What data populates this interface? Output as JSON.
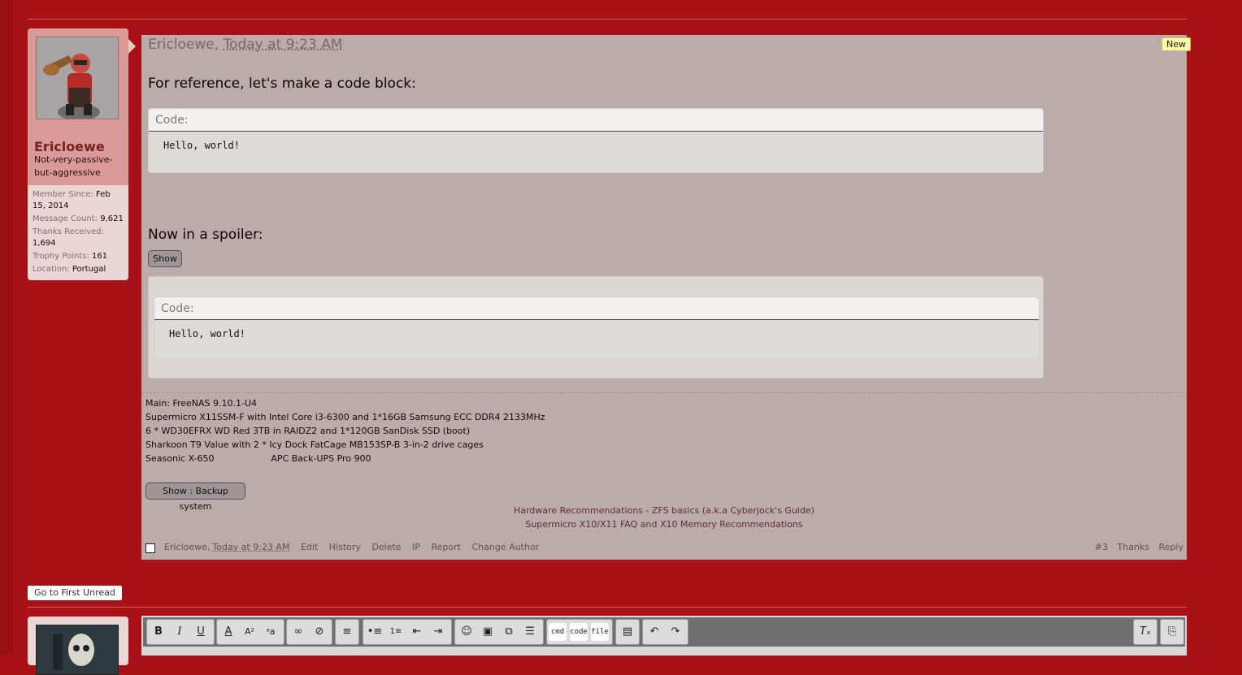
{
  "post": {
    "author": "Ericloewe",
    "author_comma": "Ericloewe,",
    "time": "Today at 9:23 AM",
    "new_badge": "New",
    "text1": "For reference, let's make a code block:",
    "code1_label": "Code:",
    "code1_content": "Hello, world!",
    "text2": "Now in a spoiler:",
    "spoiler_button": "Show",
    "code2_label": "Code:",
    "code2_content": "Hello, world!"
  },
  "user": {
    "name": "Ericloewe",
    "title": "Not-very-passive-but-aggressive",
    "stats": [
      {
        "label": "Member Since:",
        "value": "Feb 15, 2014"
      },
      {
        "label": "Message Count:",
        "value": "9,621"
      },
      {
        "label": "Thanks Received:",
        "value": "1,694"
      },
      {
        "label": "Trophy Points:",
        "value": "161"
      },
      {
        "label": "Location:",
        "value": "Portugal"
      }
    ]
  },
  "signature": {
    "lines": [
      "Main: FreeNAS 9.10.1-U4",
      "Supermicro X11SSM-F with Intel Core i3-6300 and 1*16GB Samsung ECC DDR4 2133MHz",
      "6 * WD30EFRX WD Red 3TB in RAIDZ2 and 1*120GB SanDisk SSD (boot)",
      "Sharkoon T9 Value with 2 * Icy Dock FatCage MB153SP-B 3-in-2 drive cages",
      "Seasonic X-650                    APC Back-UPS Pro 900"
    ],
    "backup_button": "Show : Backup system",
    "link1": "Hardware Recommendations",
    "link_sep": " - ",
    "link2": "ZFS basics (a.k.a Cyberjock's Guide)",
    "link3": "Supermicro X10/X11 FAQ",
    "link_and": " and ",
    "link4": "X10 Memory Recommendations"
  },
  "footer": {
    "author": "Ericloewe,",
    "time": "Today at 9:23 AM",
    "edit": "Edit",
    "history": "History",
    "delete": "Delete",
    "ip": "IP",
    "report": "Report",
    "change_author": "Change Author",
    "post_number": "#3",
    "thanks": "Thanks",
    "reply": "Reply"
  },
  "first_unread": "Go to First Unread",
  "editor": {
    "bold": "B",
    "italic": "I",
    "underline": "U",
    "cmd": "cmd",
    "code": "code",
    "file": "file"
  },
  "icons": [
    "bold-icon",
    "italic-icon",
    "underline-icon",
    "font-color-icon",
    "font-size-icon",
    "font-family-icon",
    "link-icon",
    "unlink-icon",
    "align-icon",
    "bullet-list-icon",
    "number-list-icon",
    "outdent-icon",
    "indent-icon",
    "smilie-icon",
    "image-icon",
    "media-icon",
    "more-icon",
    "save-icon",
    "undo-icon",
    "redo-icon",
    "remove-format-icon",
    "toggle-bbcode-icon"
  ]
}
